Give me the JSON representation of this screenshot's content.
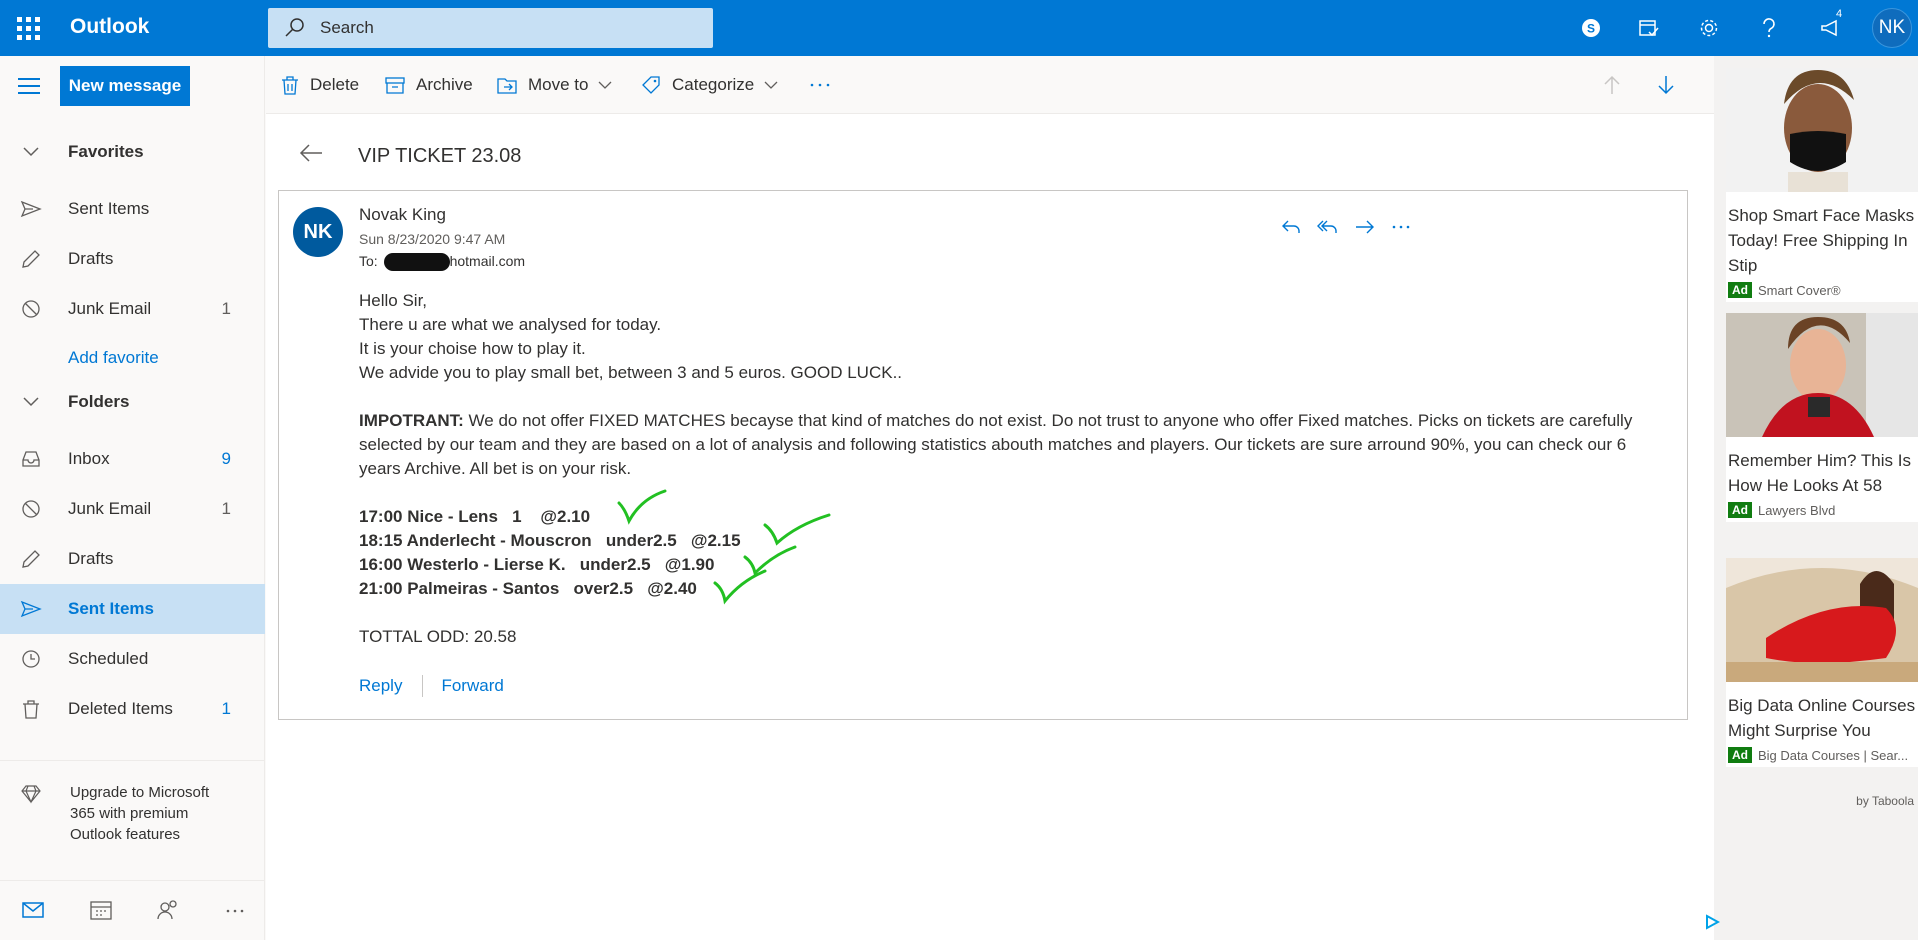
{
  "app": {
    "name": "Outlook"
  },
  "search": {
    "placeholder": "Search"
  },
  "topbar": {
    "notification_count": "4",
    "avatar_initials": "NK"
  },
  "nav": {
    "new_message": "New message",
    "favorites_label": "Favorites",
    "favorites": [
      {
        "label": "Sent Items",
        "count": ""
      },
      {
        "label": "Drafts",
        "count": ""
      },
      {
        "label": "Junk Email",
        "count": "1"
      }
    ],
    "add_favorite": "Add favorite",
    "folders_label": "Folders",
    "folders": [
      {
        "label": "Inbox",
        "count": "9"
      },
      {
        "label": "Junk Email",
        "count": "1"
      },
      {
        "label": "Drafts",
        "count": ""
      },
      {
        "label": "Sent Items",
        "count": ""
      },
      {
        "label": "Scheduled",
        "count": ""
      },
      {
        "label": "Deleted Items",
        "count": "1"
      }
    ],
    "upgrade_text": "Upgrade to Microsoft 365 with premium Outlook features"
  },
  "commands": {
    "delete": "Delete",
    "archive": "Archive",
    "move_to": "Move to",
    "categorize": "Categorize"
  },
  "message": {
    "subject": "VIP TICKET 23.08",
    "sender_initials": "NK",
    "sender_name": "Novak King",
    "date": "Sun 8/23/2020 9:47 AM",
    "to_label": "To:",
    "to_domain": "hotmail.com",
    "greeting": "Hello Sir,",
    "line1": "There u are what we analysed for today.",
    "line2": "It is your choise how to play it.",
    "line3": "We advide you to play small bet, between 3 and 5 euros. GOOD LUCK..",
    "important_label": "IMPOTRANT:",
    "important_text": " We do not offer FIXED MATCHES becayse that kind of matches do not exist. Do not trust to anyone who offer Fixed matches. Picks on tickets are carefully selected by our team and they are based on a lot of analysis and following statistics abouth matches and players. Our tickets are sure arround 90%, you can check our 6 years Archive. All bet is on your risk.",
    "picks": [
      "17:00 Nice - Lens   1    @2.10",
      "18:15 Anderlecht - Mouscron   under2.5   @2.15",
      "16:00 Westerlo - Lierse K.   under2.5   @1.90",
      "21:00 Palmeiras - Santos   over2.5   @2.40"
    ],
    "total": "TOTTAL ODD: 20.58",
    "reply": "Reply",
    "forward": "Forward"
  },
  "ads": [
    {
      "title": "Shop Smart Face Masks Today! Free Shipping In Stip",
      "badge": "Ad",
      "source": "Smart Cover®"
    },
    {
      "title": "Remember Him? This Is How He Looks At 58",
      "badge": "Ad",
      "source": "Lawyers Blvd"
    },
    {
      "title": "Big Data Online Courses Might Surprise You",
      "badge": "Ad",
      "source": "Big Data Courses | Sear..."
    }
  ],
  "ads_footer": "by Taboola",
  "colors": {
    "brand": "#0078d4",
    "selected": "#c7e0f4",
    "ad_badge": "#107c10",
    "check": "#22c022"
  }
}
